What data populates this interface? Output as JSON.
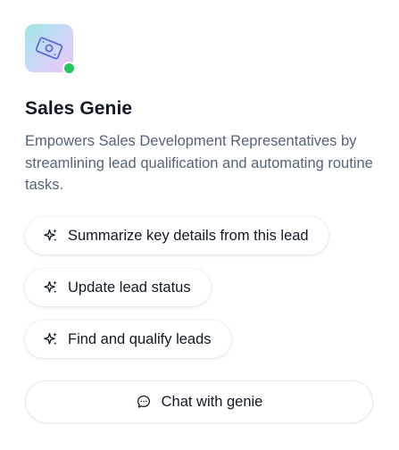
{
  "agent": {
    "name": "Sales Genie",
    "description": "Empowers Sales Development Representatives by streamlining lead qualification and automating routine tasks.",
    "avatar_icon": "money-bill-icon",
    "status": "online",
    "status_color": "#22c55e"
  },
  "prompts": [
    {
      "label": "Summarize key details from this lead",
      "icon": "sparkle-icon"
    },
    {
      "label": "Update lead status",
      "icon": "sparkle-icon"
    },
    {
      "label": "Find and qualify leads",
      "icon": "sparkle-icon"
    }
  ],
  "chat_button": {
    "label": "Chat with genie",
    "icon": "chat-bubble-icon"
  }
}
